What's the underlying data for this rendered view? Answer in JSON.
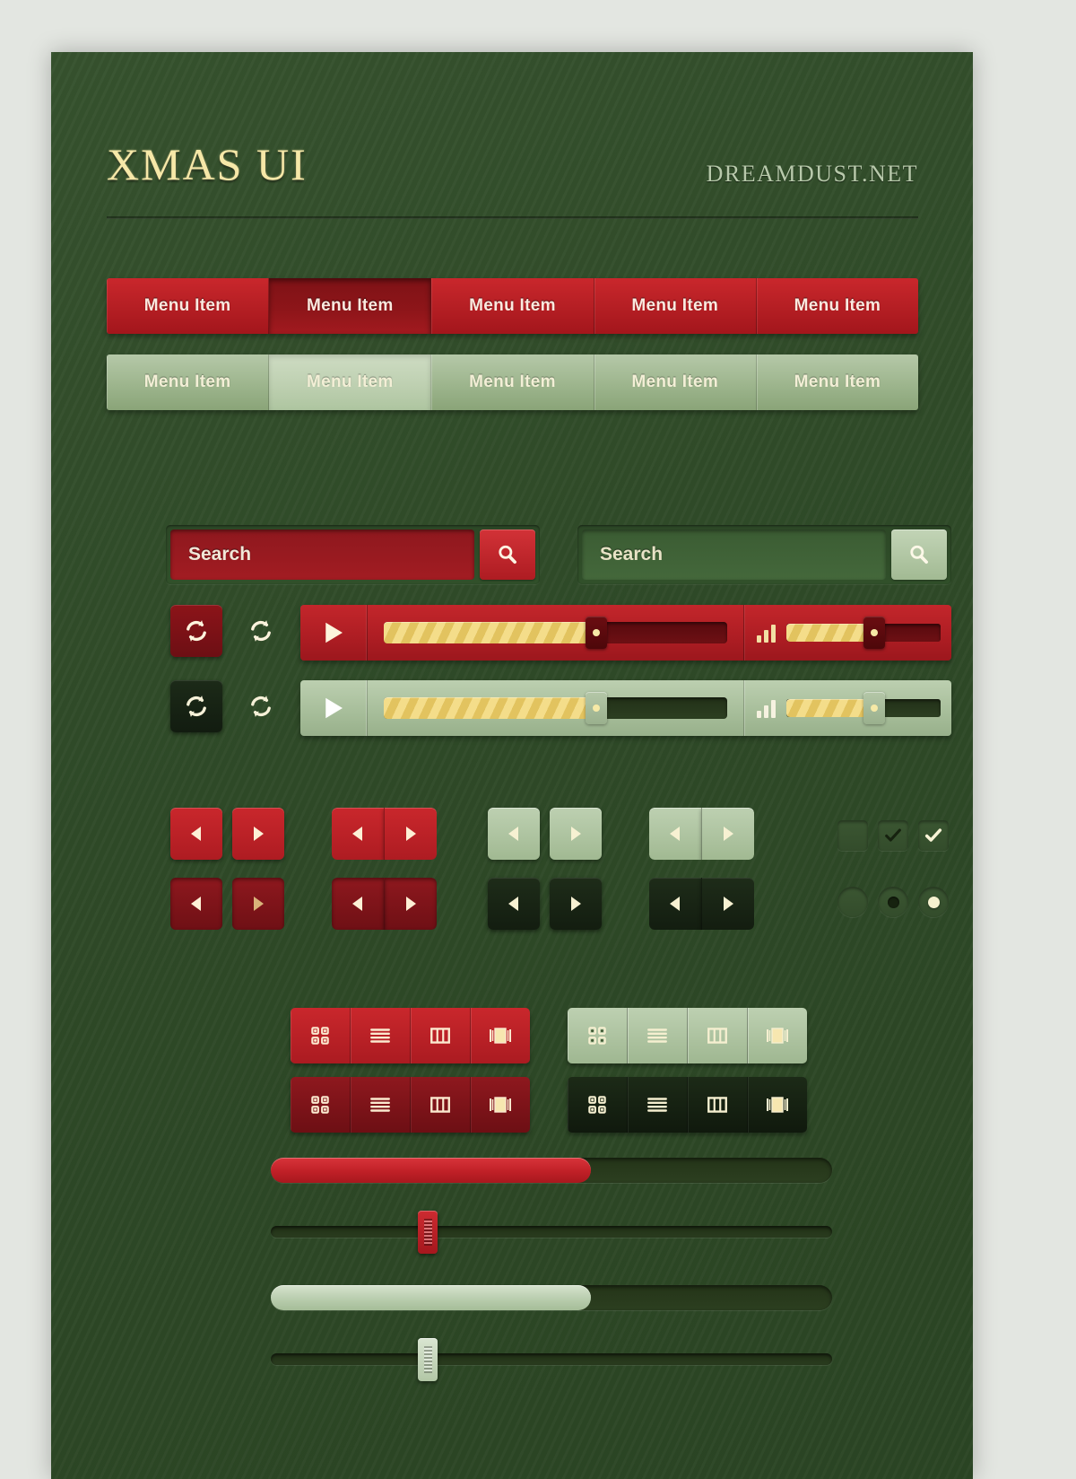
{
  "header": {
    "title": "XMAS UI",
    "site": "DREAMDUST.NET"
  },
  "menus": {
    "red": {
      "items": [
        {
          "label": "Menu Item",
          "active": false
        },
        {
          "label": "Menu Item",
          "active": true
        },
        {
          "label": "Menu Item",
          "active": false
        },
        {
          "label": "Menu Item",
          "active": false
        },
        {
          "label": "Menu Item",
          "active": false
        }
      ]
    },
    "green": {
      "items": [
        {
          "label": "Menu Item",
          "active": false
        },
        {
          "label": "Menu Item",
          "active": true
        },
        {
          "label": "Menu Item",
          "active": false
        },
        {
          "label": "Menu Item",
          "active": false
        },
        {
          "label": "Menu Item",
          "active": false
        }
      ]
    }
  },
  "search": {
    "red": {
      "value": "Search",
      "placeholder": "Search",
      "icon": "search-icon"
    },
    "green": {
      "value": "Search",
      "placeholder": "Search",
      "icon": "search-icon"
    }
  },
  "players": {
    "red": {
      "loop_filled_icon": "loop-icon",
      "loop_plain_icon": "loop-icon",
      "play_icon": "play-icon",
      "seek_percent": 62,
      "buffer_percent": 62,
      "volume_icon": "volume-bars-icon",
      "volume_percent": 57
    },
    "green": {
      "loop_filled_icon": "loop-icon",
      "loop_plain_icon": "loop-icon",
      "play_icon": "play-icon",
      "seek_percent": 62,
      "buffer_percent": 62,
      "volume_icon": "volume-bars-icon",
      "volume_percent": 57
    }
  },
  "arrow_groups": [
    {
      "style": "red-separate-up",
      "left_icon": "arrow-left-icon",
      "right_icon": "arrow-right-icon"
    },
    {
      "style": "red-joined-up",
      "left_icon": "arrow-left-icon",
      "right_icon": "arrow-right-icon"
    },
    {
      "style": "green-separate-up",
      "left_icon": "arrow-left-icon",
      "right_icon": "arrow-right-icon"
    },
    {
      "style": "green-joined-up",
      "left_icon": "arrow-left-icon",
      "right_icon": "arrow-right-icon"
    },
    {
      "style": "red-separate-down",
      "left_icon": "arrow-left-icon",
      "right_icon": "arrow-right-icon"
    },
    {
      "style": "red-joined-down",
      "left_icon": "arrow-left-icon",
      "right_icon": "arrow-right-icon"
    },
    {
      "style": "dark-separate",
      "left_icon": "arrow-left-icon",
      "right_icon": "arrow-right-icon"
    },
    {
      "style": "dark-joined",
      "left_icon": "arrow-left-icon",
      "right_icon": "arrow-right-icon"
    }
  ],
  "checkboxes": [
    {
      "state": "unchecked",
      "icon": "checkbox-empty-icon"
    },
    {
      "state": "checked-dark",
      "icon": "check-icon"
    },
    {
      "state": "checked-light",
      "icon": "check-icon"
    }
  ],
  "radios": [
    {
      "state": "unselected",
      "icon": "radio-empty-icon"
    },
    {
      "state": "selected-dark",
      "icon": "radio-dot-icon"
    },
    {
      "state": "selected-light",
      "icon": "radio-dot-icon"
    }
  ],
  "view_groups": [
    {
      "style": "red",
      "buttons": [
        {
          "icon": "grid-view-icon",
          "active": false
        },
        {
          "icon": "list-view-icon",
          "active": false
        },
        {
          "icon": "column-view-icon",
          "active": false
        },
        {
          "icon": "coverflow-view-icon",
          "active": true
        }
      ]
    },
    {
      "style": "green",
      "buttons": [
        {
          "icon": "grid-view-icon",
          "active": false
        },
        {
          "icon": "list-view-icon",
          "active": false
        },
        {
          "icon": "column-view-icon",
          "active": false
        },
        {
          "icon": "coverflow-view-icon",
          "active": true
        }
      ]
    },
    {
      "style": "dark-red",
      "buttons": [
        {
          "icon": "grid-view-icon",
          "active": false
        },
        {
          "icon": "list-view-icon",
          "active": false
        },
        {
          "icon": "column-view-icon",
          "active": false
        },
        {
          "icon": "coverflow-view-icon",
          "active": true
        }
      ]
    },
    {
      "style": "dark",
      "buttons": [
        {
          "icon": "grid-view-icon",
          "active": false
        },
        {
          "icon": "list-view-icon",
          "active": false
        },
        {
          "icon": "column-view-icon",
          "active": false
        },
        {
          "icon": "coverflow-view-icon",
          "active": true
        }
      ]
    }
  ],
  "progress": [
    {
      "type": "progress-bar",
      "style": "red",
      "percent": 57
    },
    {
      "type": "slider",
      "style": "red",
      "percent": 28
    },
    {
      "type": "progress-bar",
      "style": "green",
      "percent": 57
    },
    {
      "type": "slider",
      "style": "light",
      "percent": 28
    }
  ],
  "colors": {
    "background_green": "#2f4a28",
    "accent_red": "#c0202a",
    "accent_light_green": "#b5c8a8",
    "gold": "#f6e8a8",
    "dark": "#16220f"
  }
}
